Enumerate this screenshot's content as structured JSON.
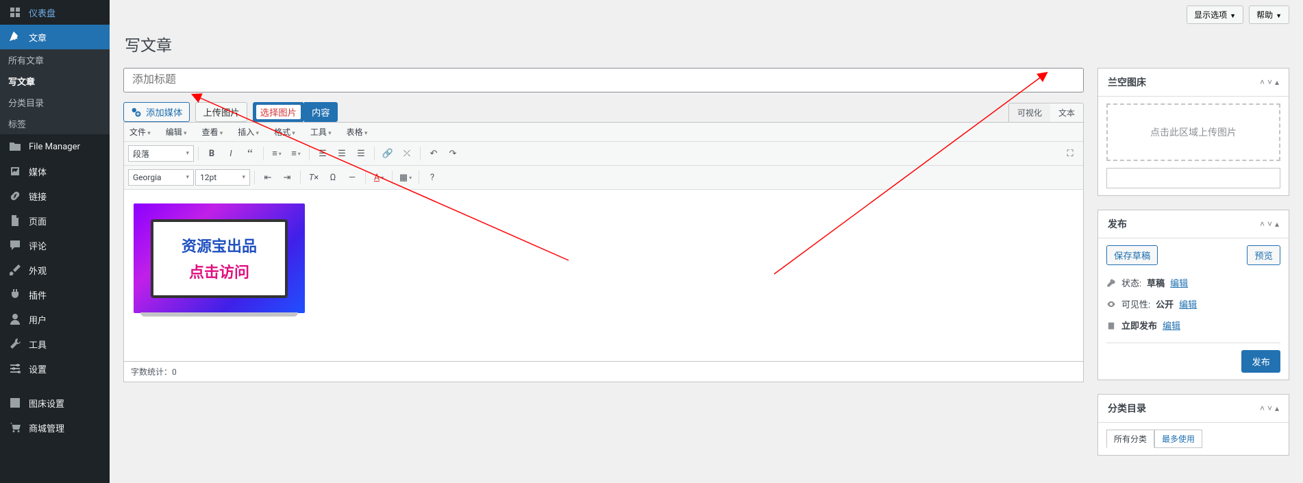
{
  "top": {
    "screen_options": "显示选项",
    "help": "帮助"
  },
  "page_title": "写文章",
  "sidebar": {
    "dashboard": "仪表盘",
    "posts": "文章",
    "all_posts": "所有文章",
    "new_post": "写文章",
    "categories": "分类目录",
    "tags": "标签",
    "file_manager": "File Manager",
    "media": "媒体",
    "links": "链接",
    "pages": "页面",
    "comments": "评论",
    "appearance": "外观",
    "plugins": "插件",
    "users": "用户",
    "tools": "工具",
    "settings": "设置",
    "imgbed": "图床设置",
    "mall": "商城管理"
  },
  "title_placeholder": "添加标题",
  "media_row": {
    "add_media": "添加媒体",
    "upload": "上传图片",
    "select": "选择图片",
    "insert": "内容"
  },
  "editor_tabs": {
    "visual": "可视化",
    "text": "文本"
  },
  "mce_menu": {
    "file": "文件",
    "edit": "编辑",
    "view": "查看",
    "insert": "插入",
    "format": "格式",
    "tools": "工具",
    "table": "表格"
  },
  "mce_fmt": "段落",
  "mce_font": "Georgia",
  "mce_size": "12pt",
  "ad": {
    "line1": "资源宝出品",
    "line2": "点击访问"
  },
  "wordcount_label": "字数统计：",
  "wordcount_value": "0",
  "box_imgbed": {
    "title": "兰空图床",
    "drop": "点击此区域上传图片"
  },
  "box_publish": {
    "title": "发布",
    "save_draft": "保存草稿",
    "preview": "预览",
    "status_label": "状态:",
    "status_val": "草稿",
    "edit": "编辑",
    "vis_label": "可见性:",
    "vis_val": "公开",
    "pub_label": "立即发布",
    "publish_btn": "发布"
  },
  "box_cat": {
    "title": "分类目录",
    "all": "所有分类",
    "most": "最多使用"
  }
}
